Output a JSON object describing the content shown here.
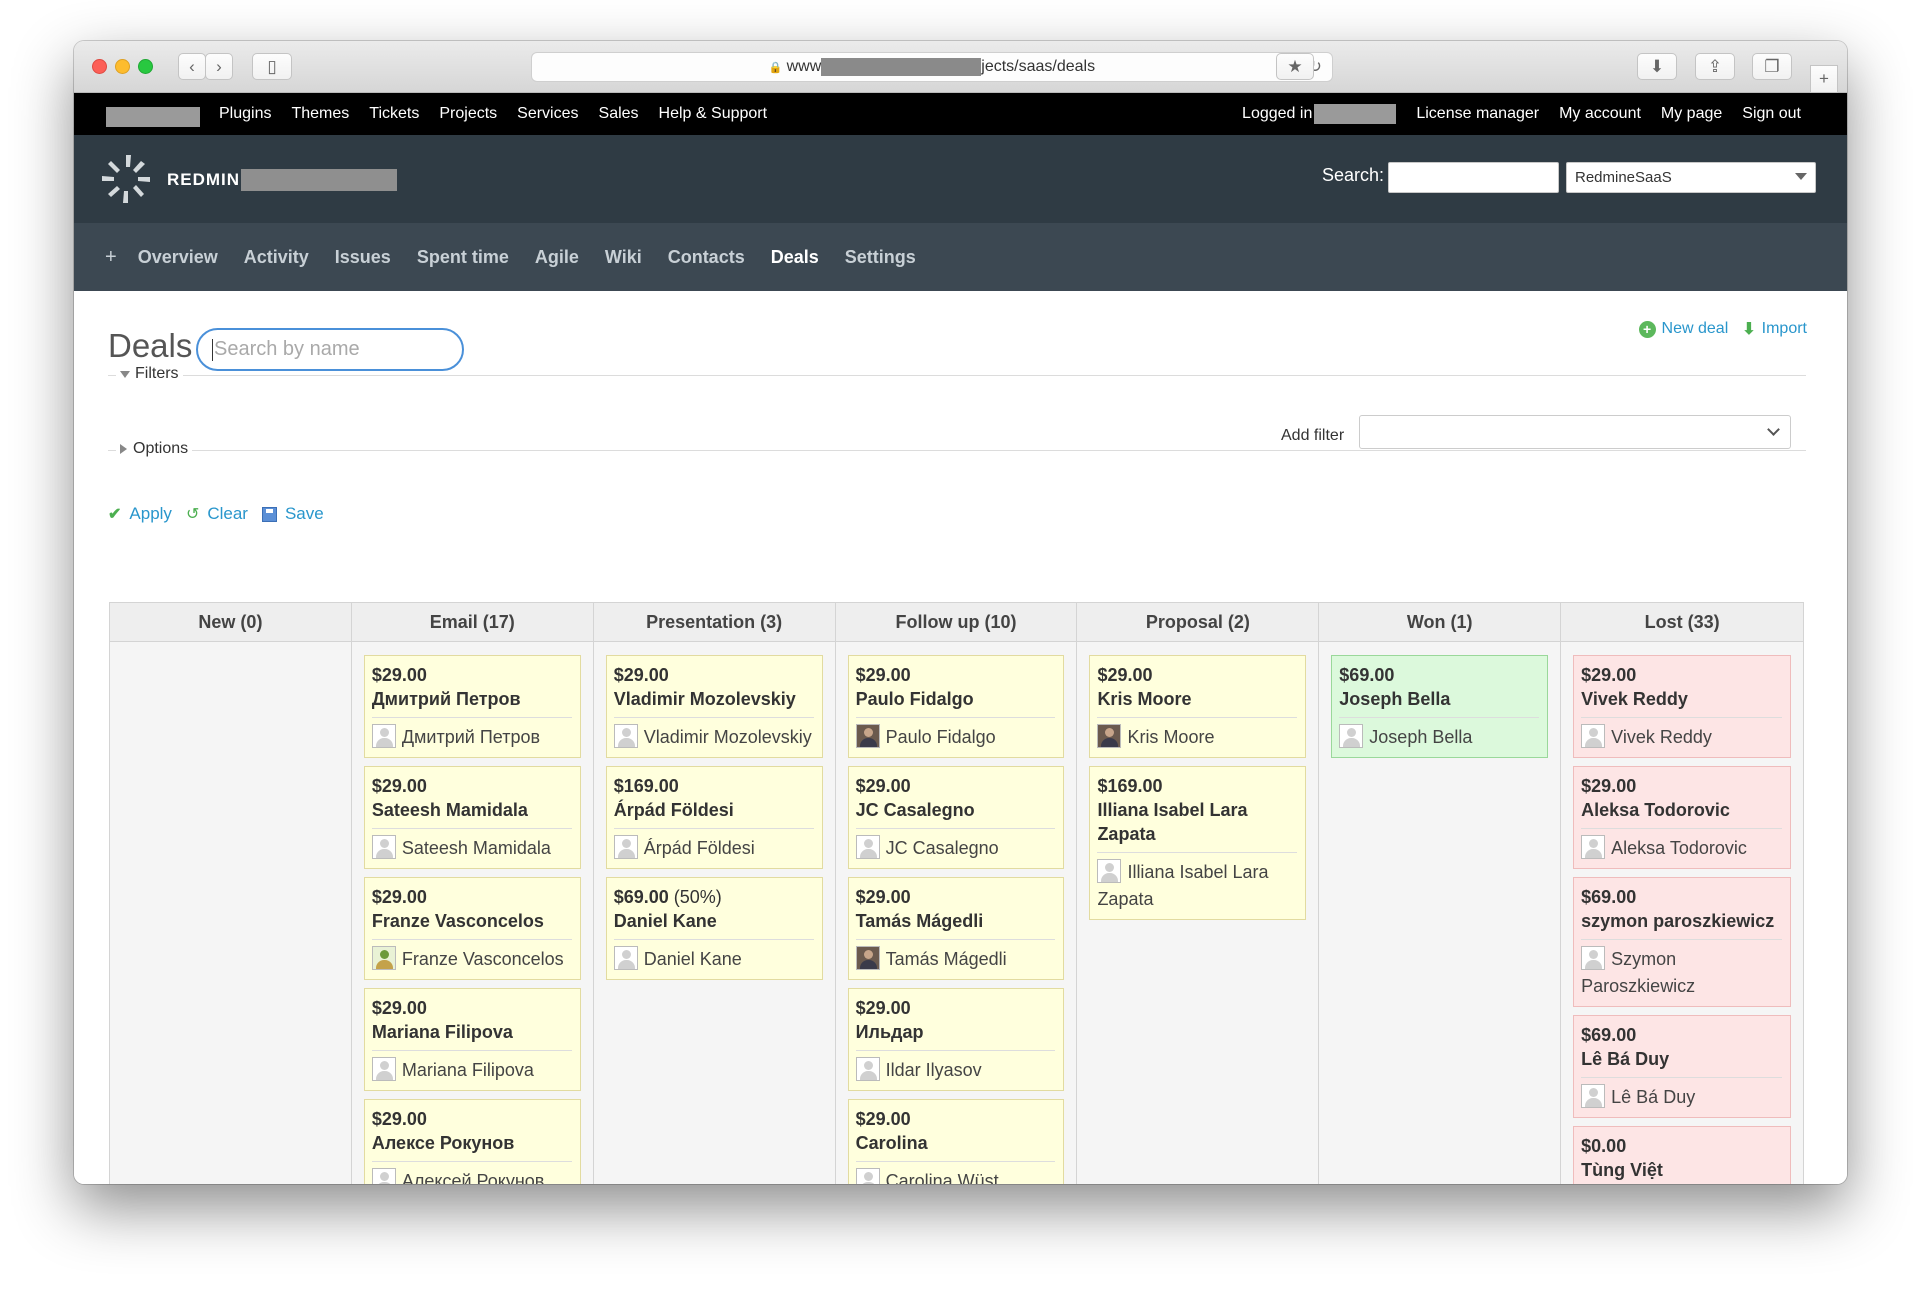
{
  "browser": {
    "url_prefix": "www",
    "url_suffix": "jects/saas/deals"
  },
  "topmenu": {
    "left": [
      "Plugins",
      "Themes",
      "Tickets",
      "Projects",
      "Services",
      "Sales",
      "Help & Support"
    ],
    "logged_as": "Logged in",
    "right": [
      "License manager",
      "My account",
      "My page",
      "Sign out"
    ]
  },
  "header": {
    "project_title": "REDMIN",
    "search_label": "Search:",
    "project_jump": "RedmineSaaS"
  },
  "main_menu": {
    "plus": "+",
    "items": [
      "Overview",
      "Activity",
      "Issues",
      "Spent time",
      "Agile",
      "Wiki",
      "Contacts",
      "Deals",
      "Settings"
    ],
    "selected": "Deals"
  },
  "page": {
    "title": "Deals",
    "search_placeholder": "Search by name",
    "new_deal": "New deal",
    "import": "Import",
    "filters_legend": "Filters",
    "add_filter_label": "Add filter",
    "options_legend": "Options",
    "apply": "Apply",
    "clear": "Clear",
    "save": "Save"
  },
  "board": {
    "columns": [
      {
        "title": "New (0)",
        "status": "normal",
        "deals": []
      },
      {
        "title": "Email (17)",
        "status": "normal",
        "deals": [
          {
            "price": "$29.00",
            "name": "Дмитрий Петров",
            "contact": "Дмитрий Петров",
            "avatar": "default"
          },
          {
            "price": "$29.00",
            "name": "Sateesh Mamidala",
            "contact": "Sateesh Mamidala",
            "avatar": "default"
          },
          {
            "price": "$29.00",
            "name": "Franze Vasconcelos",
            "contact": "Franze Vasconcelos",
            "avatar": "plant"
          },
          {
            "price": "$29.00",
            "name": "Mariana Filipova",
            "contact": "Mariana Filipova",
            "avatar": "default"
          },
          {
            "price": "$29.00",
            "name": "Алексе Рокунов",
            "contact": "Алексей Рокунов",
            "avatar": "default"
          }
        ]
      },
      {
        "title": "Presentation (3)",
        "status": "normal",
        "deals": [
          {
            "price": "$29.00",
            "name": "Vladimir Mozolevskiy",
            "contact": "Vladimir Mozolevskiy",
            "avatar": "default"
          },
          {
            "price": "$169.00",
            "name": "Árpád Földesi",
            "contact": "Árpád Földesi",
            "avatar": "default"
          },
          {
            "price": "$69.00",
            "pct": " (50%)",
            "name": "Daniel Kane",
            "contact": "Daniel Kane",
            "avatar": "default"
          }
        ]
      },
      {
        "title": "Follow up (10)",
        "status": "normal",
        "deals": [
          {
            "price": "$29.00",
            "name": "Paulo Fidalgo",
            "contact": "Paulo Fidalgo",
            "avatar": "photo"
          },
          {
            "price": "$29.00",
            "name": "JC Casalegno",
            "contact": "JC Casalegno",
            "avatar": "default"
          },
          {
            "price": "$29.00",
            "name": "Tamás Mágedli",
            "contact": "Tamás Mágedli",
            "avatar": "photo"
          },
          {
            "price": "$29.00",
            "name": "Ильдар",
            "contact": "Ildar Ilyasov",
            "avatar": "default"
          },
          {
            "price": "$29.00",
            "name": "Carolina",
            "contact": "Carolina Wüst",
            "avatar": "default"
          }
        ]
      },
      {
        "title": "Proposal (2)",
        "status": "normal",
        "deals": [
          {
            "price": "$29.00",
            "name": "Kris Moore",
            "contact": "Kris Moore",
            "avatar": "photo"
          },
          {
            "price": "$169.00",
            "name": "Illiana Isabel Lara Zapata",
            "contact": "Illiana Isabel Lara Zapata",
            "avatar": "default"
          }
        ]
      },
      {
        "title": "Won (1)",
        "status": "won",
        "deals": [
          {
            "price": "$69.00",
            "name": "Joseph Bella",
            "contact": "Joseph Bella",
            "avatar": "default"
          }
        ]
      },
      {
        "title": "Lost (33)",
        "status": "lost",
        "deals": [
          {
            "price": "$29.00",
            "name": "Vivek Reddy",
            "contact": "Vivek Reddy",
            "avatar": "default"
          },
          {
            "price": "$29.00",
            "name": "Aleksa Todorovic",
            "contact": "Aleksa Todorovic",
            "avatar": "default"
          },
          {
            "price": "$69.00",
            "name": "szymon paroszkiewicz",
            "contact": "Szymon Paroszkiewicz",
            "avatar": "default"
          },
          {
            "price": "$69.00",
            "name": "Lê Bá Duy",
            "contact": "Lê Bá Duy",
            "avatar": "default"
          },
          {
            "price": "$0.00",
            "name": "Tùng Việt",
            "contact": "",
            "avatar": "default"
          }
        ]
      }
    ]
  }
}
